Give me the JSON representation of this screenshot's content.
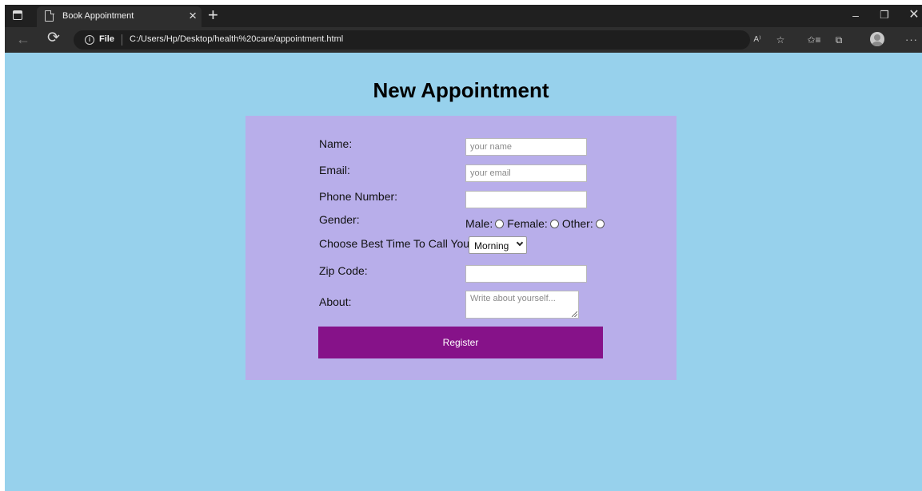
{
  "browser": {
    "tab_title": "Book Appointment",
    "tab_close": "×",
    "new_tab": "+",
    "file_label": "File",
    "url": "C:/Users/Hp/Desktop/health%20care/appointment.html",
    "window": {
      "minimize": "–",
      "restore": "❐",
      "close": "✕"
    },
    "toolbar": {
      "back": "←",
      "reload": "⟳",
      "read_aloud": "A⁾",
      "add_favorite": "☆",
      "favorites": "✩≡",
      "collections": "⧉",
      "more": "···"
    }
  },
  "page": {
    "background": "#97d1ec",
    "title": "New Appointment",
    "form": {
      "background": "#b8aeea",
      "name_label": "Name:",
      "name_placeholder": "your name",
      "email_label": "Email:",
      "email_placeholder": "your email",
      "phone_label": "Phone Number:",
      "gender_label": "Gender:",
      "gender_options": [
        "Male:",
        "Female:",
        "Other:"
      ],
      "call_time_label": "Choose Best Time To Call You",
      "call_time_value": "Morning",
      "zip_label": "Zip Code:",
      "about_label": "About:",
      "about_placeholder": "Write about yourself...",
      "submit_label": "Register",
      "submit_color": "#861289"
    }
  }
}
